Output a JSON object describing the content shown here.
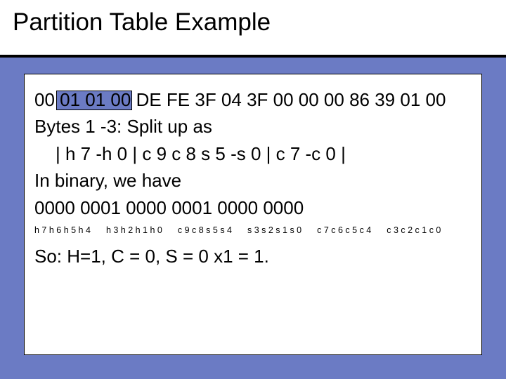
{
  "title": "Partition Table Example",
  "hex_bytes": "00 01 01 00 DE FE 3F 04 3F 00 00 00 86 39 01 00",
  "line_bytes_label": "Bytes 1 -3: Split up as",
  "line_split": "| h 7 -h 0 | c 9 c 8 s 5 -s 0 | c 7 -c 0 |",
  "line_binary_label": "In binary, we have",
  "line_binary_value": "0000 0001 0000 0001 0000  0000",
  "small_groups": [
    "h 7 h 6 h 5 h 4",
    "h 3 h 2 h 1 h 0",
    "c 9 c 8 s 5 s 4",
    "s 3 s 2 s 1 s 0",
    "c 7 c 6 c 5 c 4",
    "c 3 c 2 c 1 c 0"
  ],
  "result_line": "So: H=1, C = 0, S = 0 x1 = 1."
}
